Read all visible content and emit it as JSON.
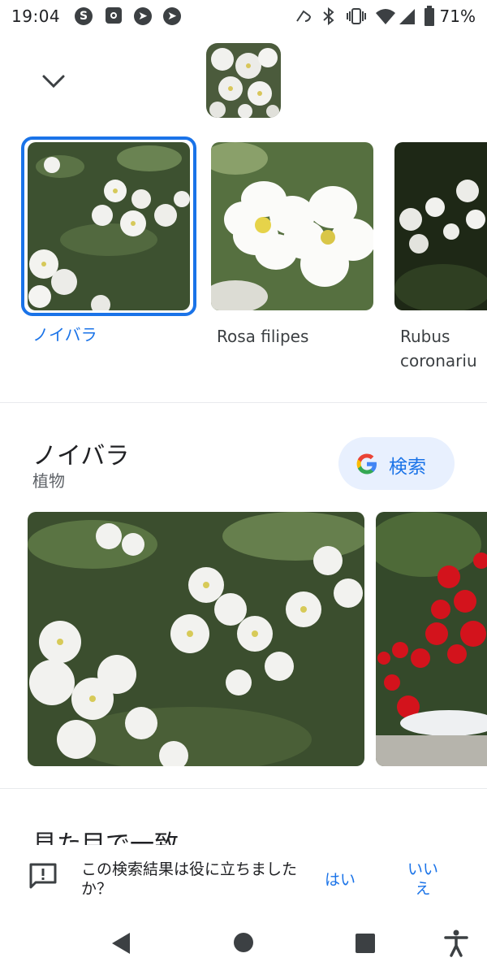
{
  "status_bar": {
    "time": "19:04",
    "battery": "71%",
    "icons": [
      "s-icon",
      "camera-icon",
      "send-icon",
      "send-icon",
      "nfc-icon",
      "bluetooth-icon",
      "vibrate-icon",
      "wifi-icon",
      "signal-icon",
      "battery-icon"
    ]
  },
  "candidates": [
    {
      "label": "ノイバラ",
      "selected": true
    },
    {
      "label": "Rosa filipes",
      "selected": false
    },
    {
      "label": "Rubus coronariu",
      "selected": false
    }
  ],
  "result": {
    "title": "ノイバラ",
    "subtitle": "植物",
    "search_label": "検索"
  },
  "partial_heading": "見た目で一致",
  "feedback": {
    "question": "この検索結果は役に立ちましたか？",
    "yes": "はい",
    "no": "いいえ"
  },
  "colors": {
    "accent": "#1a73e8",
    "chip_bg": "#e8f0fe"
  }
}
